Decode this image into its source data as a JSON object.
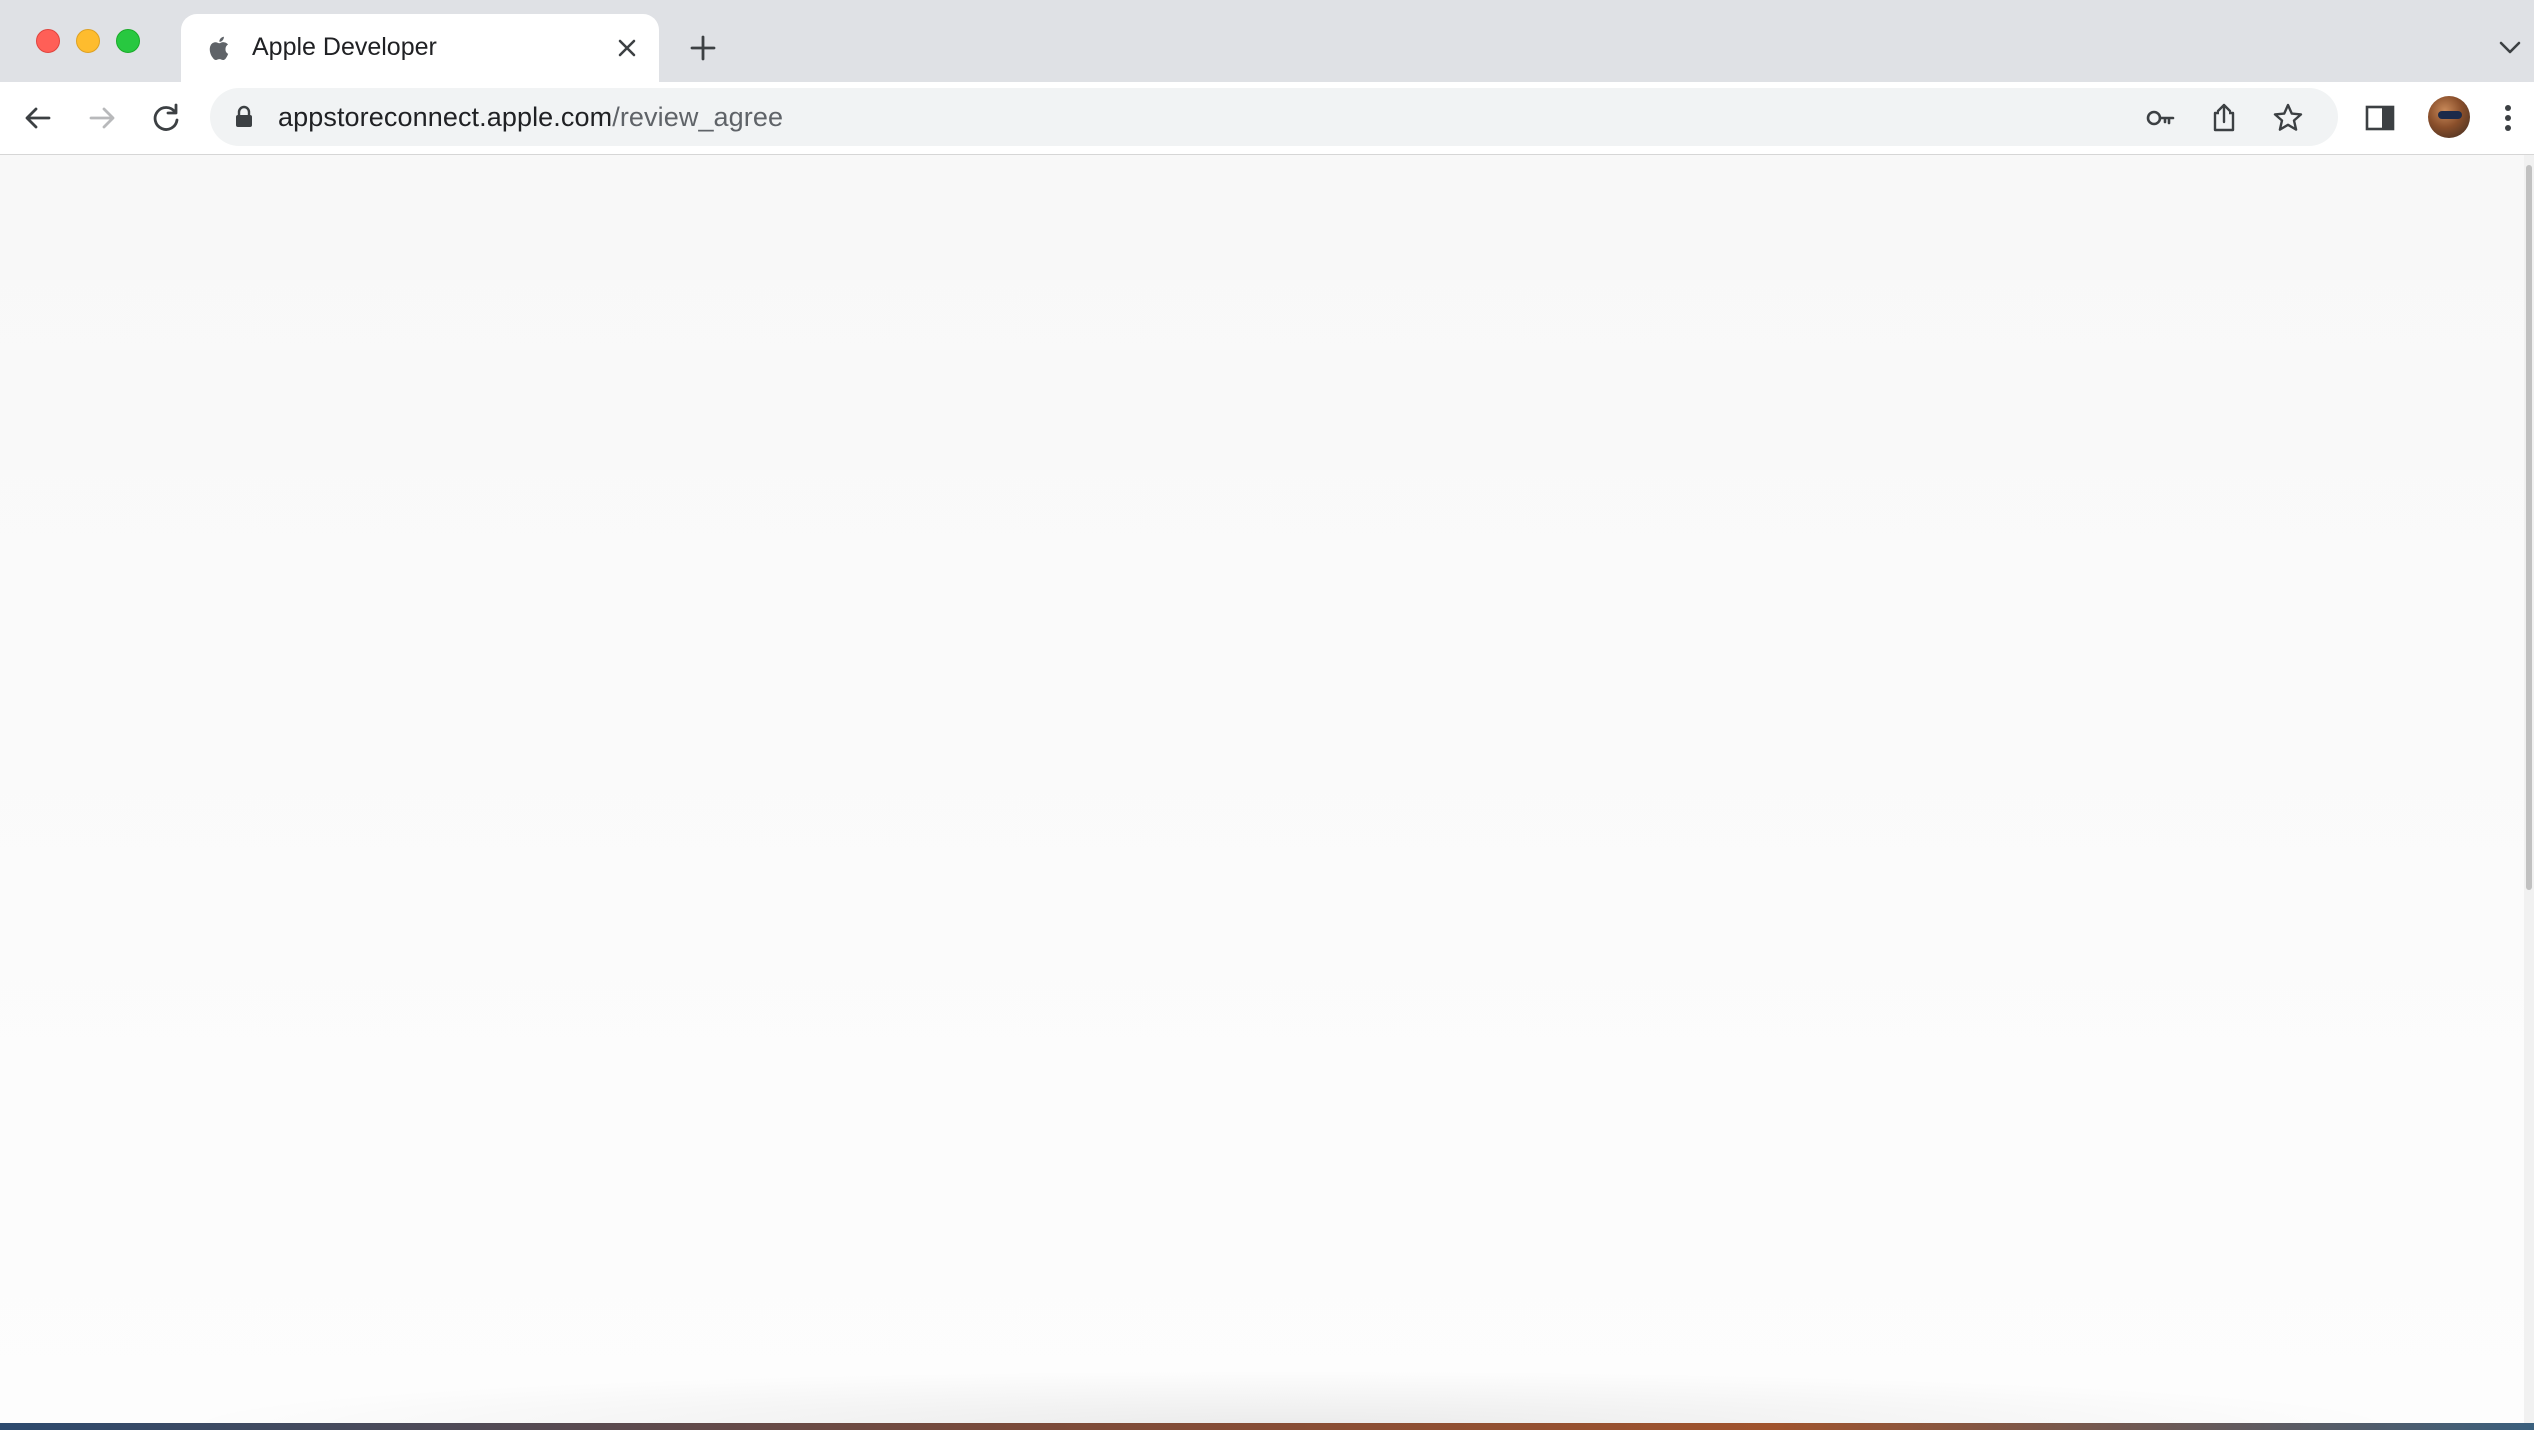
{
  "browser": {
    "tab": {
      "title": "Apple Developer",
      "favicon": "apple-logo-icon"
    },
    "address_bar": {
      "domain": "appstoreconnect.apple.com",
      "path": "/review_agree",
      "secure_icon": "lock-icon"
    },
    "toolbar_icons": [
      "back-arrow-icon",
      "forward-arrow-icon",
      "reload-icon",
      "key-icon",
      "share-icon",
      "star-icon",
      "side-panel-icon",
      "avatar",
      "more-vert-icon"
    ]
  },
  "colors": {
    "tabstrip": "#dfe1e5",
    "page_background": "#f8f8f8"
  }
}
